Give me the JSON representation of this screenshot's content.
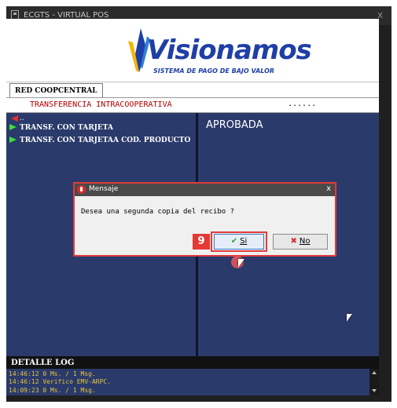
{
  "window": {
    "title": "ECGTS - VIRTUAL POS",
    "minimize": "_",
    "close": "x"
  },
  "banner": {
    "logo_text": "Visionamos",
    "logo_tagline": "SISTEMA DE PAGO DE BAJO VALOR"
  },
  "tabs": [
    {
      "label": "RED COOPCENTRAL"
    }
  ],
  "transaction": {
    "label": "TRANSFERENCIA INTRACOOPERATIVA",
    "dots": "......"
  },
  "menu": {
    "back_label": "..",
    "items": [
      {
        "label": "TRANSF. CON TARJETA"
      },
      {
        "label": "TRANSF. CON TARJETAA COD. PRODUCTO"
      }
    ]
  },
  "status": {
    "text": "APROBADA"
  },
  "dialog": {
    "title": "Mensaje",
    "close": "x",
    "message": "Desea una segunda copia del recibo ?",
    "yes_label": "Si",
    "no_label": "No",
    "step_number": "9"
  },
  "log": {
    "title": "DETALLE LOG",
    "lines": [
      "14:46:12 0 Ms. / 1 Msg.",
      "14:46:12 Verifico EMV-ARPC.",
      "14:09:23 0 Ms. / 1 Msg."
    ]
  },
  "icons": {
    "app": "app-icon",
    "back": "back-arrow-icon",
    "menu_arrow": "green-arrow-icon",
    "dialog": "stop-hand-icon",
    "yes": "check-icon",
    "no": "x-icon"
  },
  "colors": {
    "panel": "#2a3a6b",
    "brand": "#1f3fa6",
    "highlight": "#e23b3b",
    "log_text": "#e6c43a"
  }
}
